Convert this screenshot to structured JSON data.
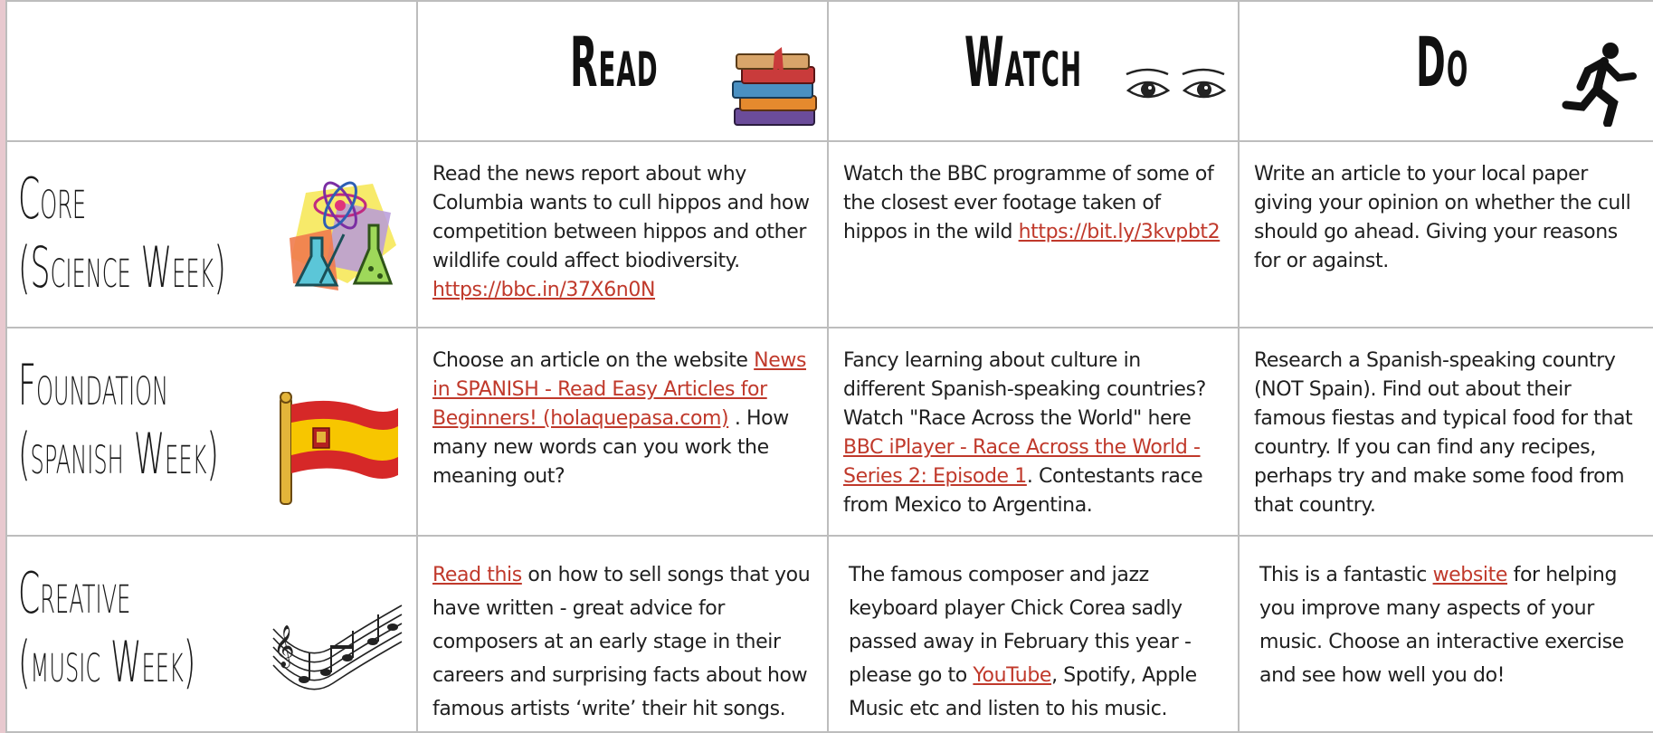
{
  "headers": {
    "read": "Read",
    "watch": "Watch",
    "do": "Do"
  },
  "rows": [
    {
      "title_line1": "Core",
      "title_line2": "(Science Week)",
      "read": {
        "text": "Read the news report about why Columbia wants to cull hippos and how competition between hippos and other wildlife could affect biodiversity.",
        "link": "https://bbc.in/37X6n0N"
      },
      "watch": {
        "text": "Watch the BBC programme of some of the closest ever footage taken of hippos in the wild",
        "link": "https://bit.ly/3kvpbt2"
      },
      "do": {
        "text": "Write an article to your local paper giving your opinion on whether the cull should go ahead. Giving your reasons for or against."
      }
    },
    {
      "title_line1": "Foundation",
      "title_line2": "(spanish Week)",
      "read": {
        "pre": "Choose an article on the website",
        "link": "News in SPANISH - Read Easy Articles for Beginners! (holaquepasa.com)",
        "post": " . How many new words can you work the meaning out?"
      },
      "watch": {
        "pre": "Fancy learning about culture in different Spanish-speaking countries? Watch \"Race Across the World\" here ",
        "link": "BBC iPlayer - Race Across the World - Series 2: Episode 1",
        "post": ". Contestants race from Mexico to Argentina."
      },
      "do": {
        "text": "Research a Spanish-speaking country (NOT Spain). Find out about their famous fiestas and typical food for that country. If you can find any recipes, perhaps try and make some food from that country."
      }
    },
    {
      "title_line1": "Creative",
      "title_line2": "(music Week)",
      "read": {
        "link": "Read this",
        "post": " on how to sell songs that you have written - great advice for composers at an early stage in their careers and surprising facts about how famous artists ‘write’ their hit songs."
      },
      "watch": {
        "pre": "The famous composer and jazz keyboard player Chick Corea sadly passed away in February this year - please go to ",
        "link": "YouTube",
        "post": ", Spotify, Apple Music etc and listen to his music."
      },
      "do": {
        "pre": "This is a fantastic ",
        "link": "website",
        "post": " for helping you improve many aspects of your music. Choose an interactive exercise and see how well you do!"
      }
    }
  ],
  "colors": {
    "link": "#c0392b",
    "border": "#bdbdbd",
    "page_bg": "#e8c9cf"
  },
  "icons": {
    "read": "books-icon",
    "watch": "eyes-icon",
    "do": "running-person-icon",
    "core": "science-lab-icon",
    "foundation": "spanish-flag-icon",
    "creative": "music-notes-icon"
  }
}
